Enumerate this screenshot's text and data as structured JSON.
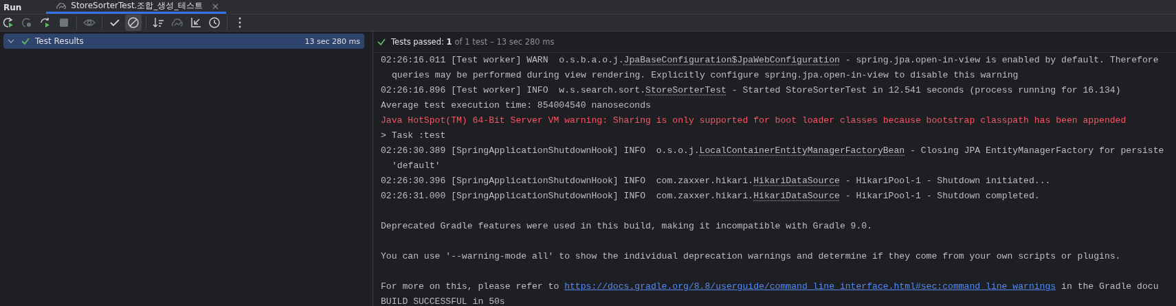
{
  "panel": {
    "title": "Run"
  },
  "tabs": [
    {
      "label": "StoreSorterTest.조합_생성_테스트",
      "selected": true,
      "close": "×"
    }
  ],
  "toolbar_groups": [
    [
      {
        "kind": "rerun",
        "disabled": false,
        "selected": false
      },
      {
        "kind": "rerun-failed",
        "disabled": true,
        "selected": false
      },
      {
        "kind": "toggle-rerun",
        "disabled": false,
        "selected": false
      },
      {
        "kind": "stop",
        "disabled": true,
        "selected": false
      }
    ],
    [
      {
        "kind": "eye",
        "disabled": true,
        "selected": false
      }
    ],
    [
      {
        "kind": "check",
        "disabled": false,
        "selected": false
      },
      {
        "kind": "ignored",
        "disabled": false,
        "selected": true
      }
    ],
    [
      {
        "kind": "sort",
        "disabled": false,
        "selected": false
      },
      {
        "kind": "ghost",
        "disabled": true,
        "selected": false
      },
      {
        "kind": "collapse",
        "disabled": false,
        "selected": false
      },
      {
        "kind": "clock",
        "disabled": false,
        "selected": false
      }
    ],
    [
      {
        "kind": "more",
        "disabled": false,
        "selected": false
      }
    ]
  ],
  "tree": [
    {
      "label": "Test Results",
      "time": "13 sec 280 ms",
      "expanded": true,
      "passed": true,
      "selected": true
    }
  ],
  "status": {
    "passed": true,
    "text": "Tests passed: **1**",
    "detail": "of 1 test – 13 sec 280 ms"
  },
  "console": [
    {
      "kind": "log",
      "gap_before": false,
      "parts": [
        {
          "t": "02:26:16.011 [Test worker] WARN  o.s.b.a.o.j.",
          "kind": "text"
        },
        {
          "t": "JpaBaseConfiguration$JpaWebConfiguration",
          "kind": "ref"
        },
        {
          "t": " - spring.jpa.open-in-view is enabled by default. Therefore",
          "kind": "text"
        }
      ]
    },
    {
      "kind": "continuation",
      "gap_before": false,
      "parts": [
        {
          "t": "queries may be performed during view rendering. Explicitly configure spring.jpa.open-in-view to disable this warning",
          "kind": "text"
        }
      ]
    },
    {
      "kind": "log",
      "gap_before": false,
      "parts": [
        {
          "t": "02:26:16.896 [Test worker] INFO  w.s.search.sort.",
          "kind": "text"
        },
        {
          "t": "StoreSorterTest",
          "kind": "ref"
        },
        {
          "t": " - Started StoreSorterTest in 12.541 seconds (process running for 16.134)",
          "kind": "text"
        }
      ]
    },
    {
      "kind": "log",
      "gap_before": false,
      "parts": [
        {
          "t": "Average test execution time: 854004540 nanoseconds",
          "kind": "text"
        }
      ]
    },
    {
      "kind": "error",
      "gap_before": false,
      "parts": [
        {
          "t": "Java HotSpot(TM) 64-Bit Server VM warning: Sharing is only supported for boot loader classes because bootstrap classpath has been appended",
          "kind": "text"
        }
      ]
    },
    {
      "kind": "log",
      "gap_before": false,
      "parts": [
        {
          "t": "> Task :test",
          "kind": "text"
        }
      ]
    },
    {
      "kind": "log",
      "gap_before": false,
      "parts": [
        {
          "t": "02:26:30.389 [SpringApplicationShutdownHook] INFO  o.s.o.j.",
          "kind": "text"
        },
        {
          "t": "LocalContainerEntityManagerFactoryBean",
          "kind": "ref"
        },
        {
          "t": " - Closing JPA EntityManagerFactory for persiste",
          "kind": "text"
        }
      ]
    },
    {
      "kind": "continuation",
      "gap_before": false,
      "parts": [
        {
          "t": "'default'",
          "kind": "text"
        }
      ]
    },
    {
      "kind": "log",
      "gap_before": false,
      "parts": [
        {
          "t": "02:26:30.396 [SpringApplicationShutdownHook] INFO  com.zaxxer.hikari.",
          "kind": "text"
        },
        {
          "t": "HikariDataSource",
          "kind": "ref"
        },
        {
          "t": " - HikariPool-1 - Shutdown initiated...",
          "kind": "text"
        }
      ]
    },
    {
      "kind": "log",
      "gap_before": false,
      "parts": [
        {
          "t": "02:26:31.000 [SpringApplicationShutdownHook] INFO  com.zaxxer.hikari.",
          "kind": "text"
        },
        {
          "t": "HikariDataSource",
          "kind": "ref"
        },
        {
          "t": " - HikariPool-1 - Shutdown completed.",
          "kind": "text"
        }
      ]
    },
    {
      "kind": "log",
      "gap_before": true,
      "parts": [
        {
          "t": "Deprecated Gradle features were used in this build, making it incompatible with Gradle 9.0.",
          "kind": "text"
        }
      ]
    },
    {
      "kind": "log",
      "gap_before": true,
      "parts": [
        {
          "t": "You can use '--warning-mode all' to show the individual deprecation warnings and determine if they come from your own scripts or plugins.",
          "kind": "text"
        }
      ]
    },
    {
      "kind": "log",
      "gap_before": true,
      "parts": [
        {
          "t": "For more on this, please refer to ",
          "kind": "text"
        },
        {
          "t": "https://docs.gradle.org/8.8/userguide/command_line_interface.html#sec:command_line_warnings",
          "kind": "url"
        },
        {
          "t": " in the Gradle docu",
          "kind": "text"
        }
      ]
    },
    {
      "kind": "log",
      "gap_before": false,
      "parts": [
        {
          "t": "BUILD SUCCESSFUL in 50s",
          "kind": "text"
        }
      ]
    }
  ]
}
